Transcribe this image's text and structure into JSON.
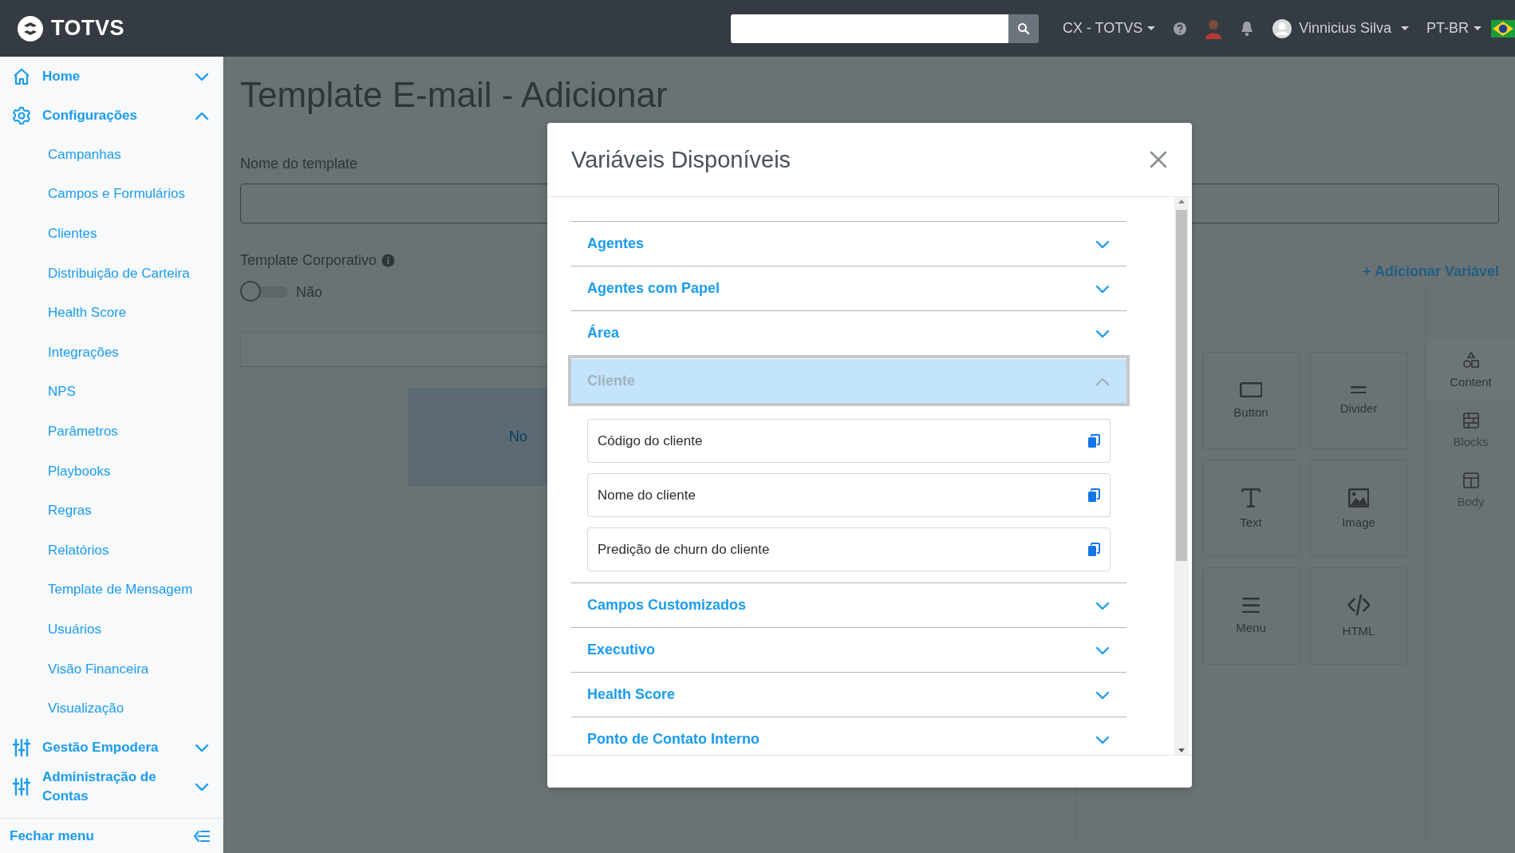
{
  "header": {
    "logo": "TOTVS",
    "org": "CX - TOTVS",
    "user": "Vinnicius Silva",
    "language": "PT-BR"
  },
  "sidebar": {
    "groups": [
      {
        "label": "Home",
        "expanded": false
      },
      {
        "label": "Configurações",
        "expanded": true,
        "children": [
          {
            "label": "Campanhas"
          },
          {
            "label": "Campos e Formulários"
          },
          {
            "label": "Clientes"
          },
          {
            "label": "Distribuição de Carteira"
          },
          {
            "label": "Health Score"
          },
          {
            "label": "Integrações"
          },
          {
            "label": "NPS"
          },
          {
            "label": "Parâmetros"
          },
          {
            "label": "Playbooks"
          },
          {
            "label": "Regras"
          },
          {
            "label": "Relatórios"
          },
          {
            "label": "Template de Mensagem"
          },
          {
            "label": "Usuários"
          },
          {
            "label": "Visão Financeira"
          },
          {
            "label": "Visualização"
          }
        ]
      },
      {
        "label": "Gestão Empodera",
        "expanded": false
      },
      {
        "label": "Administração de Contas",
        "expanded": false
      }
    ],
    "collapse": "Fechar menu"
  },
  "page": {
    "title": "Template E-mail - Adicionar",
    "name_label": "Nome do template",
    "corporate_label": "Template Corporativo",
    "corporate_toggle": {
      "on": false,
      "label": "Não"
    },
    "add_variable": "+ Adicionar Variável",
    "canvas_hint": "No",
    "tiles": [
      {
        "label": "Button"
      },
      {
        "label": "Divider"
      },
      {
        "label": "Text"
      },
      {
        "label": "Image"
      },
      {
        "label": "Menu"
      },
      {
        "label": "HTML"
      }
    ],
    "tabs": [
      {
        "label": "Content",
        "selected": true
      },
      {
        "label": "Blocks",
        "selected": false
      },
      {
        "label": "Body",
        "selected": false
      }
    ]
  },
  "modal": {
    "title": "Variáveis Disponíveis",
    "sections": [
      {
        "label": "Agentes",
        "expanded": false
      },
      {
        "label": "Agentes com Papel",
        "expanded": false
      },
      {
        "label": "Área",
        "expanded": false
      },
      {
        "label": "Cliente",
        "expanded": true,
        "variables": [
          {
            "label": "Código do cliente"
          },
          {
            "label": "Nome do cliente"
          },
          {
            "label": "Predição de churn do cliente"
          }
        ]
      },
      {
        "label": "Campos Customizados",
        "expanded": false
      },
      {
        "label": "Executivo",
        "expanded": false
      },
      {
        "label": "Health Score",
        "expanded": false
      },
      {
        "label": "Ponto de Contato Interno",
        "expanded": false
      }
    ]
  }
}
